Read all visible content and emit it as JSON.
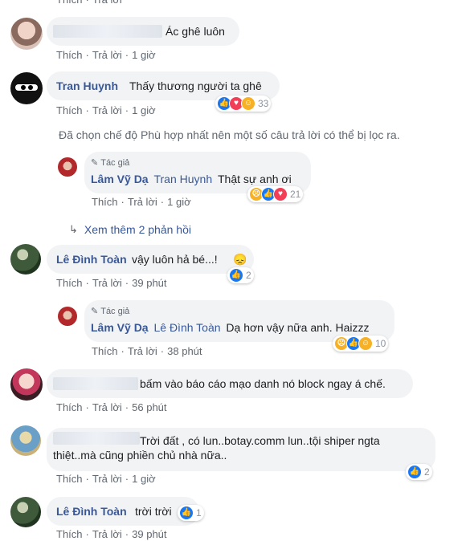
{
  "actions": {
    "like": "Thích",
    "reply": "Trả lời",
    "dot": "·"
  },
  "comments": [
    {
      "id": "c1",
      "name": "",
      "text": "Ác ghê luôn",
      "time": "1 giờ"
    },
    {
      "id": "c2",
      "name": "Tran Huynh",
      "text": "Thấy thương người ta ghê",
      "time": "1 giờ",
      "reaction_count": "33"
    },
    {
      "id": "c3",
      "name": "Lê Đình Toàn",
      "text": "vậy luôn hả bé...!",
      "time": "39 phút",
      "reaction_count": "2"
    },
    {
      "id": "c4",
      "name": "",
      "text": "bấm vào báo cáo mạo danh nó block ngay á chế.",
      "time": "56 phút"
    },
    {
      "id": "c5",
      "name": "",
      "text": "Trời đất , có lun..botay.comm lun..tội shiper ngta thiệt..mà cũng phiền chủ nhà nữa..",
      "time": "1 giờ",
      "reaction_count": "2"
    },
    {
      "id": "c6",
      "name": "Lê Đình Toàn",
      "text": "trời trời",
      "time": "39 phút",
      "reaction_count": "1"
    }
  ],
  "replies": [
    {
      "id": "r1",
      "badge": "Tác giả",
      "name": "Lâm Vỹ Dạ",
      "mention": "Tran Huynh",
      "text": "Thật sự anh ơi",
      "time": "1 giờ",
      "reaction_count": "21"
    },
    {
      "id": "r2",
      "badge": "Tác giả",
      "name": "Lâm Vỹ Dạ",
      "mention": "Lê Đình Toàn",
      "text": "Dạ hơn vậy nữa anh. Haizzz",
      "time": "38 phút",
      "reaction_count": "10"
    }
  ],
  "notice": "Đã chọn chế độ Phù hợp nhất nên một số câu trả lời có thể bị lọc ra.",
  "more_replies": "Xem thêm 2 phản hồi",
  "emoji": {
    "sad": "😞"
  },
  "colors": {
    "name": "#385898",
    "like": "#1877f2",
    "love": "#f33e58",
    "haha": "#f7b125",
    "bubble": "#f2f3f5"
  }
}
